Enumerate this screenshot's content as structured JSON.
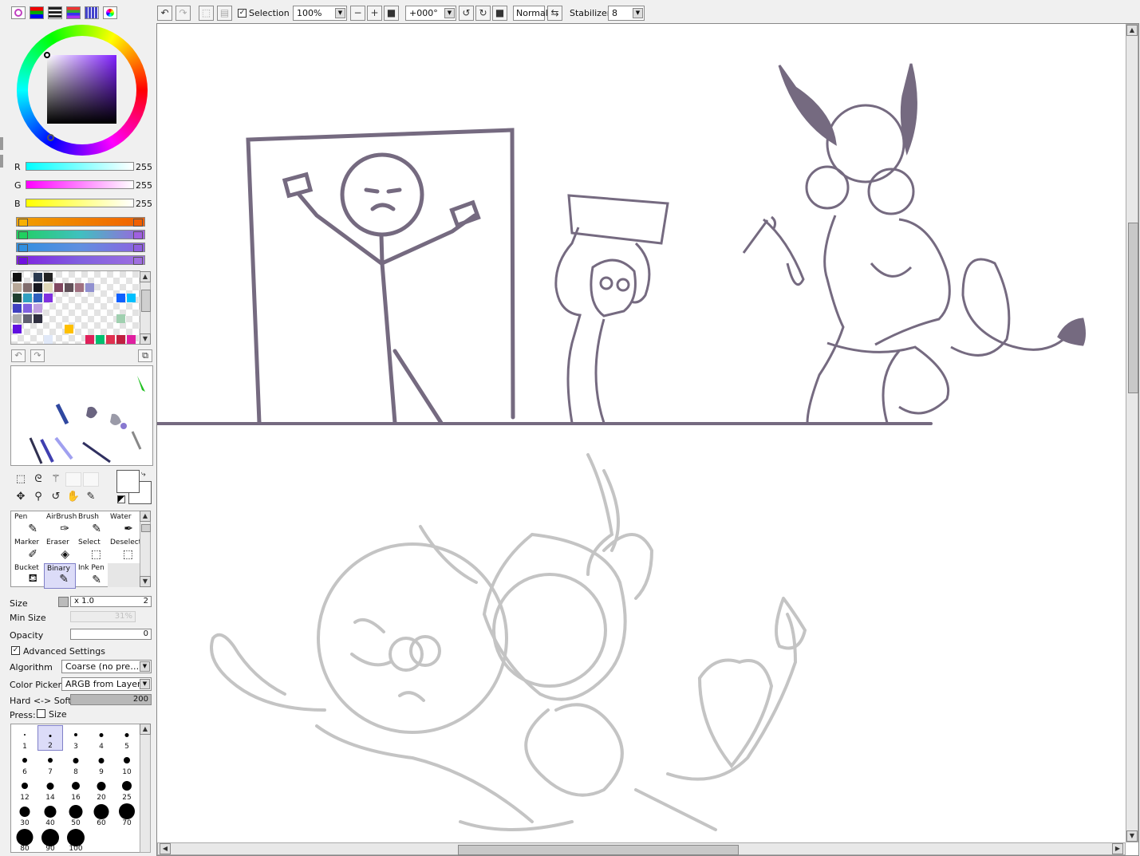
{
  "toolbar": {
    "selection_label": "Selection",
    "selection_checked": true,
    "zoom_value": "100%",
    "rotation_value": "+000°",
    "blend_value": "Normal",
    "stabilizer_label": "Stabilizer",
    "stabilizer_value": "8"
  },
  "color_panel": {
    "r_label": "R",
    "r_value": "255",
    "g_label": "G",
    "g_value": "255",
    "b_label": "B",
    "b_value": "255"
  },
  "tools": {
    "row1": [
      "Pen",
      "AirBrush",
      "Brush",
      "Water"
    ],
    "row2": [
      "Marker",
      "Eraser",
      "Select",
      "Deselect"
    ],
    "row3": [
      "Bucket",
      "Binary",
      "Ink Pen"
    ],
    "selected": "Binary"
  },
  "properties": {
    "size_label": "Size",
    "size_multiplier": "x 1.0",
    "size_value": "2",
    "min_size_label": "Min Size",
    "min_size_value": "31%",
    "opacity_label": "Opacity",
    "opacity_value": "0",
    "advanced_label": "Advanced Settings",
    "advanced_checked": true,
    "algorithm_label": "Algorithm",
    "algorithm_value": "Coarse (no pre…",
    "colorpicker_label": "Color Picker",
    "colorpicker_value": "ARGB from Layer",
    "hardsoft_label": "Hard <-> Soft",
    "hardsoft_value": "200",
    "press_label": "Press:",
    "press_size_label": "Size"
  },
  "brush_sizes": [
    "1",
    "2",
    "3",
    "4",
    "5",
    "6",
    "7",
    "8",
    "9",
    "10",
    "12",
    "14",
    "16",
    "20",
    "25",
    "30",
    "40",
    "50",
    "60",
    "70",
    "80",
    "90",
    "100"
  ],
  "brush_size_selected": "2",
  "colors": {
    "sketch_top": "#756a80",
    "sketch_bottom": "#c4c4c4",
    "panel_bg": "#f0f0f0",
    "selected_tool_bg": "#dcdcf8"
  }
}
